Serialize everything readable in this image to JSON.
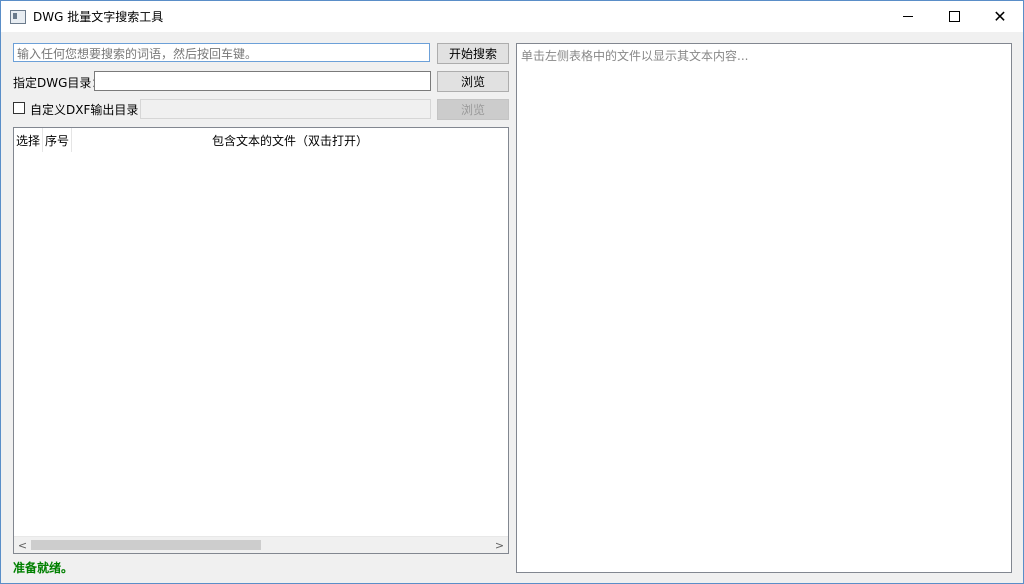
{
  "window": {
    "title": "DWG 批量文字搜索工具",
    "controls": {
      "minimize": "minimize",
      "maximize": "maximize",
      "close": "✕"
    }
  },
  "search": {
    "placeholder": "输入任何您想要搜索的词语，然后按回车键。",
    "value": "",
    "button_label": "开始搜索"
  },
  "dwg_dir": {
    "label": "指定DWG目录：",
    "value": "",
    "browse_label": "浏览"
  },
  "dxf_output": {
    "checkbox_label": "自定义DXF输出目录",
    "checked": false,
    "value": "",
    "browse_label": "浏览"
  },
  "results_table": {
    "columns": [
      "选择",
      "序号",
      "包含文本的文件（双击打开）"
    ],
    "rows": [],
    "scroll_left_arrow": "<",
    "scroll_right_arrow": ">"
  },
  "preview": {
    "placeholder": "单击左侧表格中的文件以显示其文本内容..."
  },
  "status": {
    "text": "准备就绪。",
    "color": "#008000"
  }
}
